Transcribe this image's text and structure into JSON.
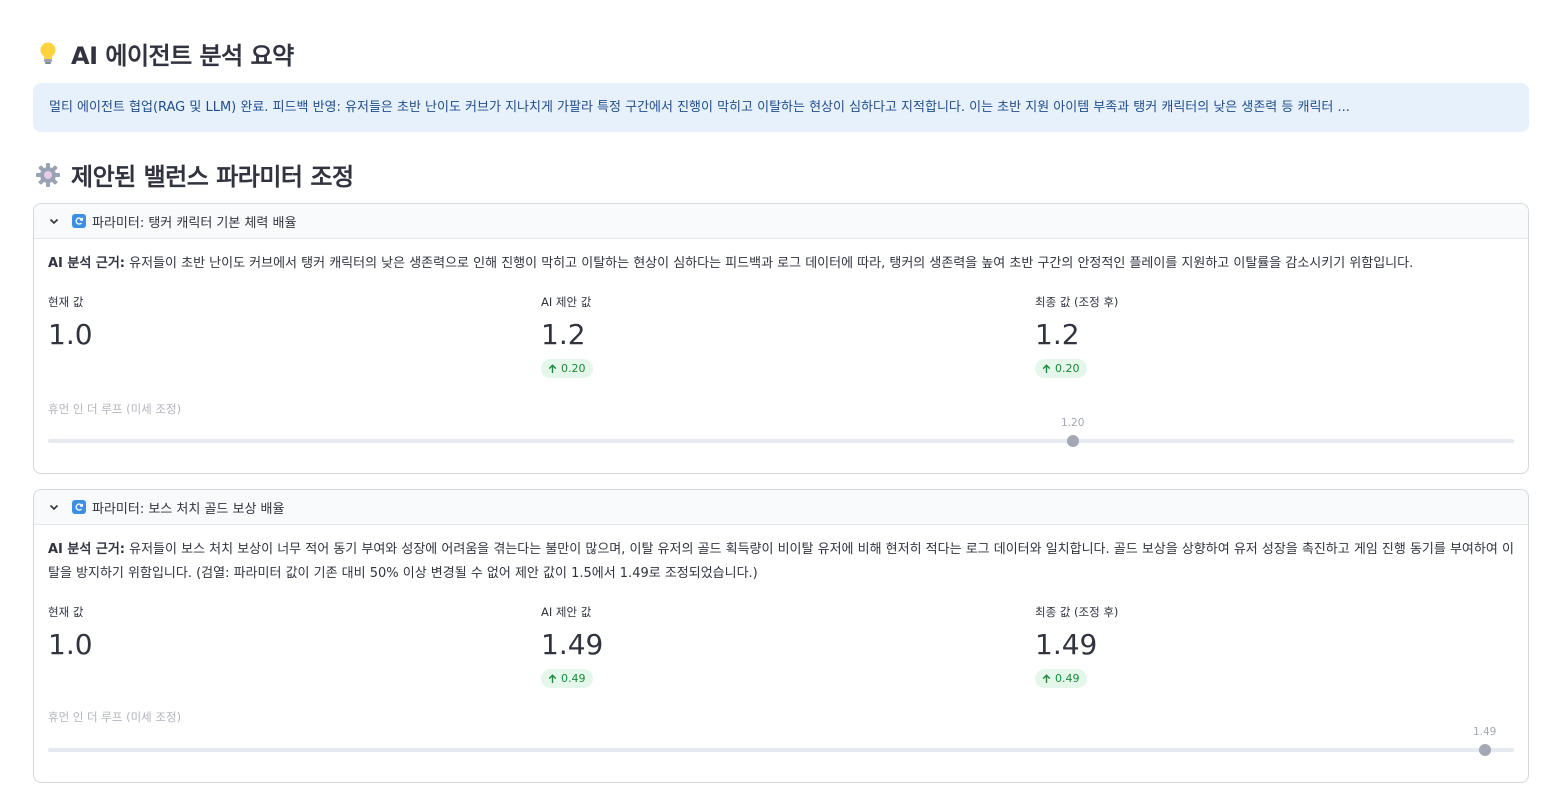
{
  "summary": {
    "title": "AI 에이전트 분석 요약",
    "icon": "lightbulb-icon",
    "message": "멀티 에이전트 협업(RAG 및 LLM) 완료. 피드백 반영: 유저들은 초반 난이도 커브가 지나치게 가팔라 특정 구간에서 진행이 막히고 이탈하는 현상이 심하다고 지적합니다. 이는 초반 지원 아이템 부족과 탱커 캐릭터의 낮은 생존력 등 캐릭터 ..."
  },
  "adjustments": {
    "title": "제안된 밸런스 파라미터 조정",
    "icon": "gear-icon",
    "rationale_label": "AI 분석 근거:",
    "current_label": "현재 값",
    "suggested_label": "AI 제안 값",
    "final_label": "최종 값 (조정 후)",
    "slider_label": "휴먼 인 더 루프 (미세 조정)",
    "params": [
      {
        "title": "파라미터: 탱커 캐릭터 기본 체력 배율",
        "rationale": " 유저들이 초반 난이도 커브에서 탱커 캐릭터의 낮은 생존력으로 인해 진행이 막히고 이탈하는 현상이 심하다는 피드백과 로그 데이터에 따라, 탱커의 생존력을 높여 초반 구간의 안정적인 플레이를 지원하고 이탈률을 감소시키기 위함입니다.",
        "current": "1.0",
        "suggested": "1.2",
        "suggested_delta": "0.20",
        "final": "1.2",
        "final_delta": "0.20",
        "slider_value": "1.20",
        "slider_fraction": 0.699
      },
      {
        "title": "파라미터: 보스 처치 골드 보상 배율",
        "rationale": " 유저들이 보스 처치 보상이 너무 적어 동기 부여와 성장에 어려움을 겪는다는 불만이 많으며, 이탈 유저의 골드 획득량이 비이탈 유저에 비해 현저히 적다는 로그 데이터와 일치합니다. 골드 보상을 상향하여 유저 성장을 촉진하고 게임 진행 동기를 부여하여 이탈을 방지하기 위함입니다. (검열: 파라미터 값이 기존 대비 50% 이상 변경될 수 없어 제안 값이 1.5에서 1.49로 조정되었습니다.)",
        "current": "1.0",
        "suggested": "1.49",
        "suggested_delta": "0.49",
        "final": "1.49",
        "final_delta": "0.49",
        "slider_value": "1.49",
        "slider_fraction": 0.98
      }
    ]
  }
}
